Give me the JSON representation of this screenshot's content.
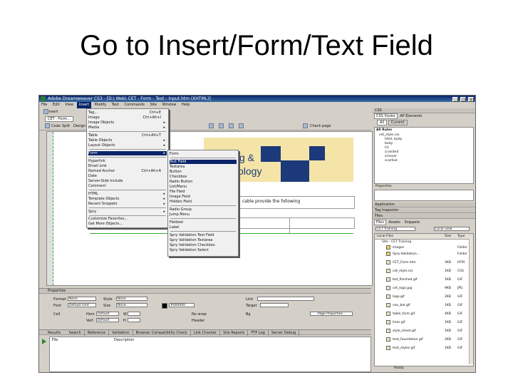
{
  "slide": {
    "title": "Go to Insert/Form/Text Field"
  },
  "window": {
    "title": "Adobe Dreamweaver CS3 - [D:\\ Web\\ CET - Form - Text - Input.htm (XHTML)]",
    "controls": [
      "_",
      "□",
      "x"
    ]
  },
  "menubar": {
    "items": [
      "File",
      "Edit",
      "View",
      "Insert",
      "Modify",
      "Text",
      "Commands",
      "Site",
      "Window",
      "Help"
    ]
  },
  "insert_bar": {
    "label": "Insert"
  },
  "doc_toolbar": {
    "tab": "CET - Form...",
    "code_label": "Code",
    "split_label": "Split",
    "design_label": "Design",
    "check_page": "Check page"
  },
  "document": {
    "brand_line1": "g &",
    "brand_line2": "ology",
    "intro": "cable provide the following"
  },
  "insert_menu": {
    "items": [
      {
        "label": "Tag...",
        "shortcut": "Ctrl+E",
        "arrow": ""
      },
      {
        "label": "Image",
        "shortcut": "Ctrl+Alt+I",
        "arrow": ""
      },
      {
        "label": "Image Objects",
        "shortcut": "",
        "arrow": "▸"
      },
      {
        "label": "Media",
        "shortcut": "",
        "arrow": "▸"
      },
      {
        "label": "Table",
        "shortcut": "Ctrl+Alt+T",
        "arrow": ""
      },
      {
        "label": "Table Objects",
        "shortcut": "",
        "arrow": "▸"
      },
      {
        "label": "Layout Objects",
        "shortcut": "",
        "arrow": "▸"
      },
      {
        "label": "Form",
        "shortcut": "",
        "arrow": "▸"
      },
      {
        "label": "Hyperlink",
        "shortcut": "",
        "arrow": ""
      },
      {
        "label": "Email Link",
        "shortcut": "",
        "arrow": ""
      },
      {
        "label": "Named Anchor",
        "shortcut": "Ctrl+Alt+A",
        "arrow": ""
      },
      {
        "label": "Date",
        "shortcut": "",
        "arrow": ""
      },
      {
        "label": "Server-Side Include",
        "shortcut": "",
        "arrow": ""
      },
      {
        "label": "Comment",
        "shortcut": "",
        "arrow": ""
      },
      {
        "label": "HTML",
        "shortcut": "",
        "arrow": "▸"
      },
      {
        "label": "Template Objects",
        "shortcut": "",
        "arrow": "▸"
      },
      {
        "label": "Recent Snippets",
        "shortcut": "",
        "arrow": "▸"
      },
      {
        "label": "Spry",
        "shortcut": "",
        "arrow": "▸"
      },
      {
        "label": "Customize Favorites...",
        "shortcut": "",
        "arrow": ""
      },
      {
        "label": "Get More Objects...",
        "shortcut": "",
        "arrow": ""
      }
    ]
  },
  "form_menu": {
    "items": [
      {
        "label": "Form"
      },
      {
        "label": "Text Field"
      },
      {
        "label": "Textarea"
      },
      {
        "label": "Button"
      },
      {
        "label": "Checkbox"
      },
      {
        "label": "Radio Button"
      },
      {
        "label": "List/Menu"
      },
      {
        "label": "File Field"
      },
      {
        "label": "Image Field"
      },
      {
        "label": "Hidden Field"
      },
      {
        "label": "Radio Group"
      },
      {
        "label": "Jump Menu"
      },
      {
        "label": "Fieldset"
      },
      {
        "label": "Label"
      },
      {
        "label": "Spry Validation Text Field"
      },
      {
        "label": "Spry Validation Textarea"
      },
      {
        "label": "Spry Validation Checkbox"
      },
      {
        "label": "Spry Validation Select"
      }
    ]
  },
  "css_panel": {
    "header": "CSS",
    "tabs": [
      "CSS Styles",
      "AP Elements"
    ],
    "all_label": "All",
    "current_label": "Current",
    "rules_header": "All Rules",
    "rules": [
      "cet_style.css",
      "html, body",
      "body",
      "h1",
      "a:visited",
      "a:hover",
      "a:active"
    ],
    "properties_header": "Properties"
  },
  "side_panels": [
    "Application",
    "Tag Inspector",
    "Files"
  ],
  "files_panel": {
    "tabs": [
      "Files",
      "Assets",
      "Snippets"
    ],
    "site": "CET Training",
    "view": "Local view",
    "columns": [
      "Local Files",
      "Size",
      "Type"
    ],
    "root": "Site - CET Training",
    "files": [
      {
        "name": "images",
        "size": "",
        "type": "Folder"
      },
      {
        "name": "Spry-Validation...",
        "size": "",
        "type": "Folder"
      },
      {
        "name": "CET_Form.htm",
        "size": "3KB",
        "type": "HTM"
      },
      {
        "name": "cet_style.css",
        "size": "1KB",
        "type": "CSS"
      },
      {
        "name": "bot_finished.gif",
        "size": "1KB",
        "type": "GIF"
      },
      {
        "name": "cet_logo.jpg",
        "size": "9KB",
        "type": "JPG"
      },
      {
        "name": "logo.gif",
        "size": "2KB",
        "type": "GIF"
      },
      {
        "name": "nav_bar.gif",
        "size": "1KB",
        "type": "GIF"
      },
      {
        "name": "table_form.gif",
        "size": "4KB",
        "type": "GIF"
      },
      {
        "name": "lines.gif",
        "size": "1KB",
        "type": "GIF"
      },
      {
        "name": "style_sheet.gif",
        "size": "1KB",
        "type": "GIF"
      },
      {
        "name": "text_foundation.gif",
        "size": "2KB",
        "type": "GIF"
      },
      {
        "name": "text_styles.gif",
        "size": "1KB",
        "type": "GIF"
      }
    ],
    "status": "Ready"
  },
  "properties": {
    "header": "Properties",
    "format_label": "Format",
    "format_value": "None",
    "style_label": "Style",
    "style_value": "None",
    "font_label": "Font",
    "font_value": "Default Font",
    "size_label": "Size",
    "size_value": "None",
    "color_value": "#000000",
    "link_label": "Link",
    "target_label": "Target",
    "cell_label": "Cell",
    "horz_label": "Horz",
    "horz_value": "Default",
    "vert_label": "Vert",
    "vert_value": "Default",
    "w_label": "W",
    "h_label": "H",
    "nowrap_label": "No wrap",
    "header_label": "Header",
    "bg_label": "Bg",
    "page_props": "Page Properties..."
  },
  "results": {
    "header": "Results",
    "tabs": [
      "Search",
      "Reference",
      "Validation",
      "Browser Compatibility Check",
      "Link Checker",
      "Site Reports",
      "FTP Log",
      "Server Debug"
    ],
    "columns": [
      "File",
      "Description"
    ]
  }
}
